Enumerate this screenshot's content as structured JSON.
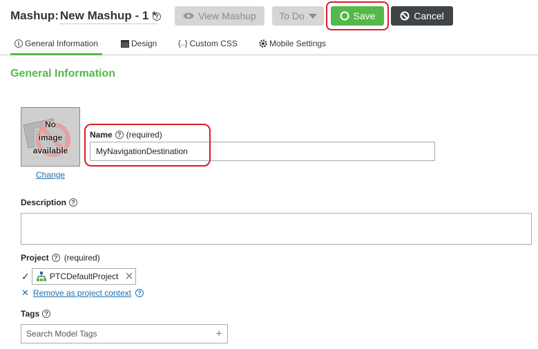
{
  "header": {
    "label": "Mashup:",
    "name": "New Mashup - 1 *",
    "buttons": {
      "view": "View Mashup",
      "todo": "To Do",
      "save": "Save",
      "cancel": "Cancel"
    }
  },
  "tabs": [
    {
      "label": "General Information",
      "icon": "info-icon",
      "active": true
    },
    {
      "label": "Design",
      "icon": "design-icon"
    },
    {
      "label": "Custom CSS",
      "icon": "braces-icon"
    },
    {
      "label": "Mobile Settings",
      "icon": "gear-icon"
    }
  ],
  "section_title": "General Information",
  "image": {
    "placeholder_text": [
      "No",
      "image",
      "available"
    ],
    "change_link": "Change"
  },
  "name_field": {
    "label": "Name",
    "required": "(required)",
    "value": "MyNavigationDestination"
  },
  "description_field": {
    "label": "Description",
    "value": ""
  },
  "project_field": {
    "label": "Project",
    "required": "(required)",
    "value": "PTCDefaultProject",
    "remove_link": "Remove as project context"
  },
  "tags_field": {
    "label": "Tags",
    "placeholder": "Search Model Tags"
  },
  "colors": {
    "accent_green": "#54b84a",
    "annotation_red": "#d81c28",
    "link_blue": "#1b6fb0"
  }
}
